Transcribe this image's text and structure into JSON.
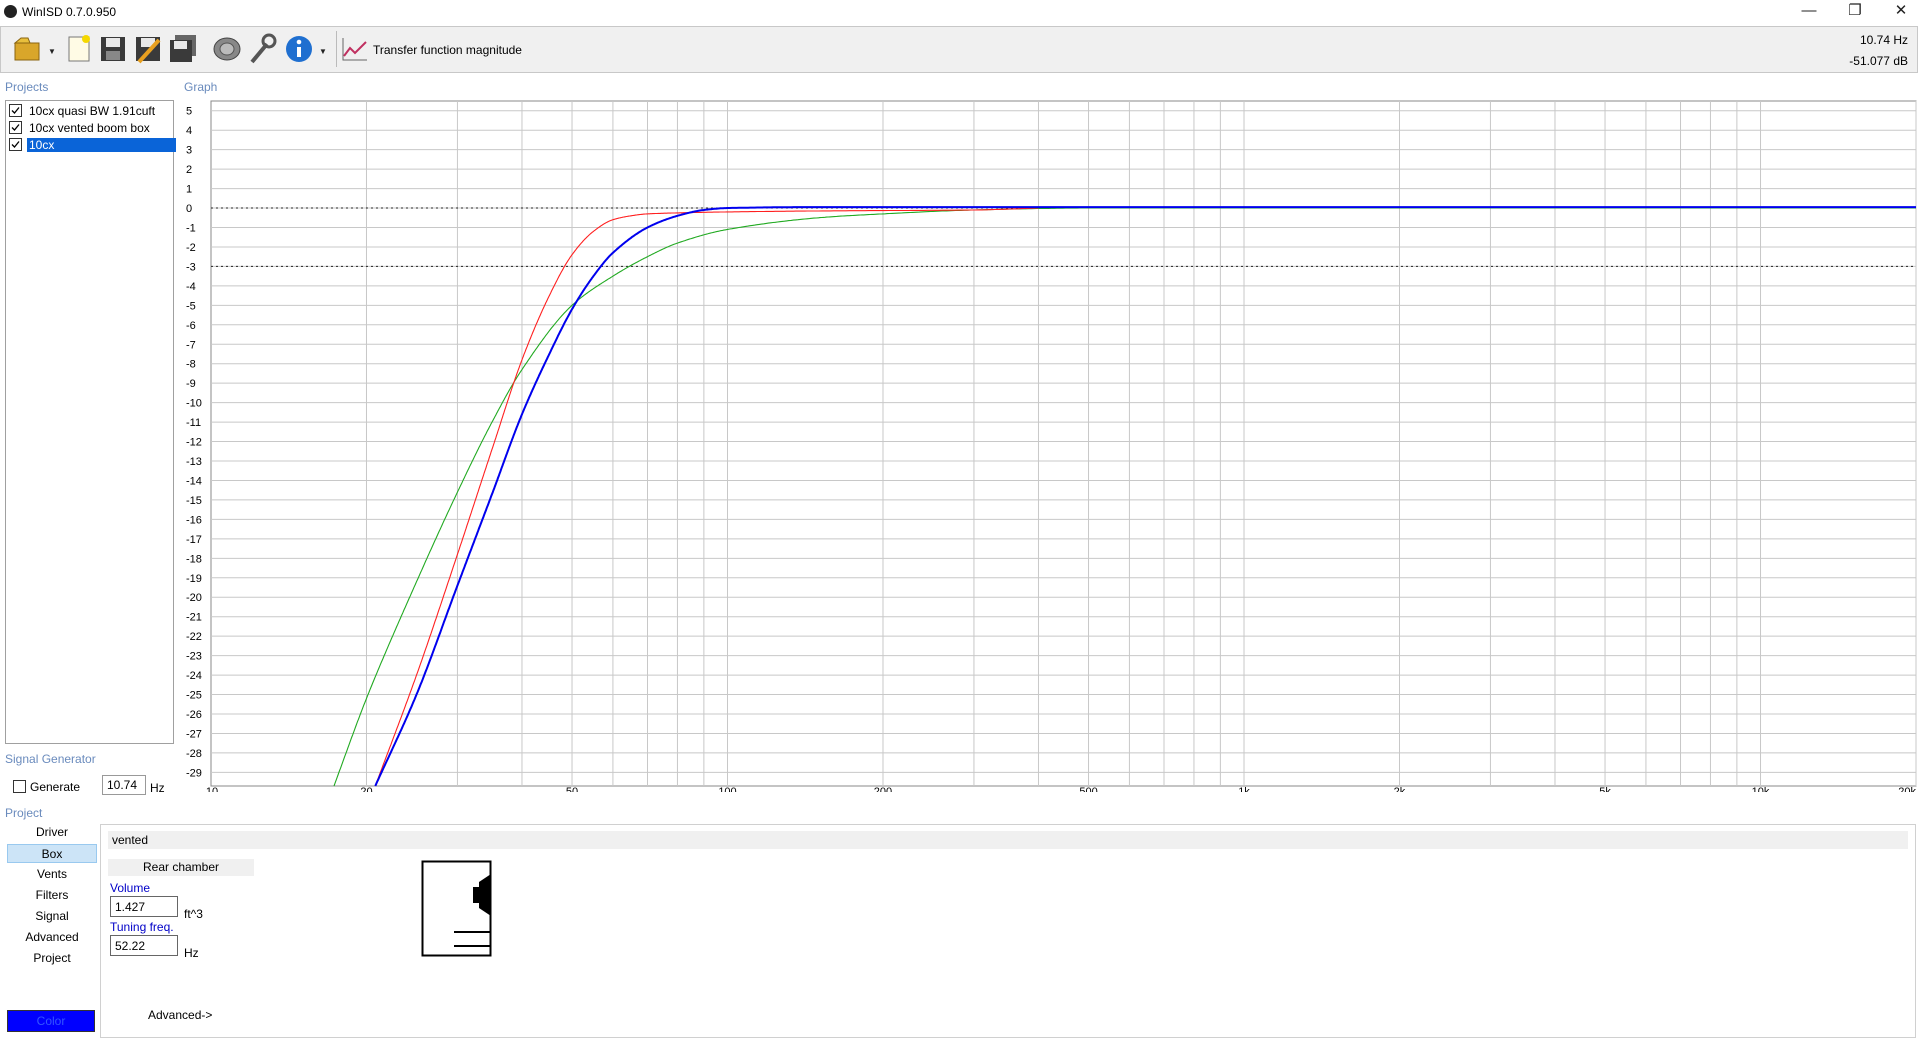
{
  "window": {
    "title": "WinISD 0.7.0.950",
    "controls": {
      "minimize": "—",
      "restore": "❐",
      "close": "✕"
    }
  },
  "toolbar": {
    "buttons": [
      "open-icon",
      "new-icon",
      "save-icon",
      "save-as-icon",
      "save-all-icon",
      "driver-icon",
      "tools-icon",
      "info-icon",
      "graph-icon"
    ],
    "graph_label": "Transfer function magnitude",
    "readout_hz": "10.74 Hz",
    "readout_db": "-51.077 dB"
  },
  "sections": {
    "projects": "Projects",
    "graph": "Graph",
    "signal_generator": "Signal Generator",
    "project": "Project"
  },
  "projects": [
    {
      "label": "10cx quasi BW 1.91cuft",
      "checked": true,
      "selected": false
    },
    {
      "label": "10cx vented boom box",
      "checked": true,
      "selected": false
    },
    {
      "label": "10cx",
      "checked": true,
      "selected": true
    }
  ],
  "signal_generator": {
    "label": "Generate",
    "checked": false,
    "value": "10.74",
    "unit": "Hz"
  },
  "project_nav": [
    "Driver",
    "Box",
    "Vents",
    "Filters",
    "Signal",
    "Advanced",
    "Project"
  ],
  "project_nav_active": "Box",
  "color_button": "Color",
  "box": {
    "type": "vented",
    "chamber_header": "Rear chamber",
    "volume_label": "Volume",
    "volume_value": "1.427",
    "volume_unit": "ft^3",
    "tuning_label": "Tuning freq.",
    "tuning_value": "52.22",
    "tuning_unit": "Hz",
    "advanced_link": "Advanced->"
  },
  "colors": {
    "series_green": "#22aa22",
    "series_red": "#ff2020",
    "series_blue": "#0000ee",
    "selection": "#0a64d8",
    "grid": "#c8c8c8"
  },
  "chart_data": {
    "type": "line",
    "x_scale": "log",
    "xlim": [
      10,
      20000
    ],
    "ylim": [
      -29.7,
      5.5
    ],
    "x_ticks": [
      {
        "value": 10,
        "label": "10"
      },
      {
        "value": 20,
        "label": "20"
      },
      {
        "value": 50,
        "label": "50"
      },
      {
        "value": 100,
        "label": "100"
      },
      {
        "value": 200,
        "label": "200"
      },
      {
        "value": 500,
        "label": "500"
      },
      {
        "value": 1000,
        "label": "1k"
      },
      {
        "value": 2000,
        "label": "2k"
      },
      {
        "value": 5000,
        "label": "5k"
      },
      {
        "value": 10000,
        "label": "10k"
      },
      {
        "value": 20000,
        "label": "20k"
      }
    ],
    "y_ticks": [
      5,
      4,
      3,
      2,
      1,
      0,
      -1,
      -2,
      -3,
      -4,
      -5,
      -6,
      -7,
      -8,
      -9,
      -10,
      -11,
      -12,
      -13,
      -14,
      -15,
      -16,
      -17,
      -18,
      -19,
      -20,
      -21,
      -22,
      -23,
      -24,
      -25,
      -26,
      -27,
      -28,
      -29
    ],
    "reference_lines": [
      0,
      -3
    ],
    "grid": true,
    "series": [
      {
        "color": "#22aa22",
        "x": [
          17.3,
          20,
          25,
          30,
          35,
          40,
          50,
          60,
          70,
          80,
          100,
          150,
          200,
          300,
          500,
          1000,
          20000
        ],
        "y": [
          -29.7,
          -25.2,
          -19.2,
          -14.6,
          -11.0,
          -8.3,
          -5.0,
          -3.5,
          -2.5,
          -1.8,
          -1.1,
          -0.5,
          -0.3,
          -0.1,
          0,
          0,
          0
        ]
      },
      {
        "color": "#ff2020",
        "x": [
          20.8,
          25,
          30,
          35,
          40,
          45,
          50,
          55,
          60,
          65,
          70,
          80,
          100,
          150,
          300,
          400
        ],
        "y": [
          -29.7,
          -24.0,
          -17.8,
          -12.4,
          -7.8,
          -4.6,
          -2.4,
          -1.2,
          -0.6,
          -0.4,
          -0.3,
          -0.25,
          -0.2,
          -0.15,
          -0.1,
          0
        ]
      },
      {
        "color": "#0000ee",
        "x": [
          20.8,
          25,
          30,
          35,
          40,
          45,
          50,
          55,
          60,
          70,
          80,
          90,
          100,
          150,
          500,
          20000
        ],
        "y": [
          -29.7,
          -25.0,
          -19.4,
          -14.7,
          -10.6,
          -7.6,
          -5.2,
          -3.5,
          -2.3,
          -1.0,
          -0.4,
          -0.1,
          0,
          0.05,
          0.05,
          0.05
        ]
      }
    ]
  }
}
